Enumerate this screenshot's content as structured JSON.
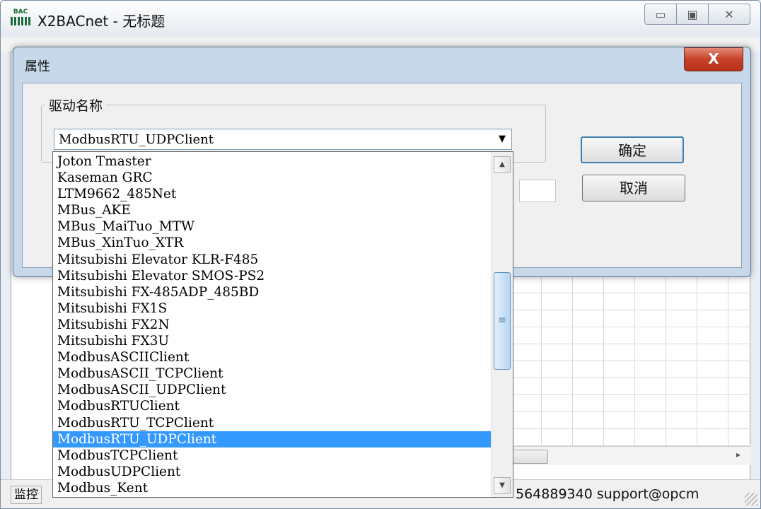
{
  "main_window": {
    "title": "X2BACnet - 无标题",
    "app_icon_text": "BAC",
    "window_buttons": {
      "minimize": "▭",
      "maximize": "▣",
      "close": "✕"
    }
  },
  "status_bar": {
    "left_text": "监控",
    "right_text": "564889340 support@opcm"
  },
  "dialog": {
    "title": "属性",
    "close_label": "X",
    "group_label": "驱动名称",
    "combo_value": "ModbusRTU_UDPClient",
    "ok_label": "确定",
    "cancel_label": "取消"
  },
  "dropdown": {
    "items": [
      "Joton Tmaster",
      "Kaseman GRC",
      "LTM9662_485Net",
      "MBus_AKE",
      "MBus_MaiTuo_MTW",
      "MBus_XinTuo_XTR",
      "Mitsubishi Elevator KLR-F485",
      "Mitsubishi Elevator SMOS-PS2",
      "Mitsubishi FX-485ADP_485BD",
      "Mitsubishi FX1S",
      "Mitsubishi FX2N",
      "Mitsubishi FX3U",
      "ModbusASCIIClient",
      "ModbusASCII_TCPClient",
      "ModbusASCII_UDPClient",
      "ModbusRTUClient",
      "ModbusRTU_TCPClient",
      "ModbusRTU_UDPClient",
      "ModbusTCPClient",
      "ModbusUDPClient",
      "Modbus_Kent"
    ],
    "selected_index": 17
  },
  "colors": {
    "selection": "#3399ff",
    "dialog_frame": "#c6d8ea",
    "close_button": "#c7412a"
  }
}
